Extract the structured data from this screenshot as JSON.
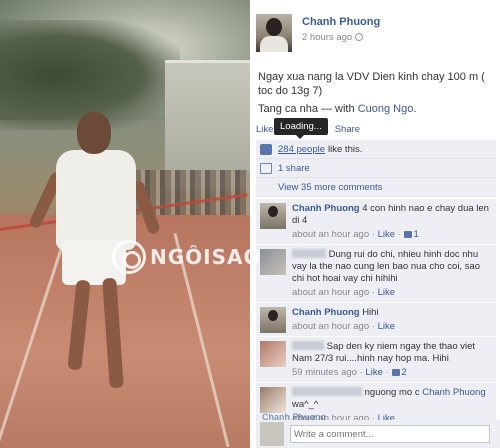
{
  "post": {
    "author": "Chanh Phuong",
    "time": "2 hours ago",
    "text_line1": "Ngay xua nang la VDV Dien kinh chay 100 m ( toc do 13g 7)",
    "text_line2_prefix": "Tang ca nha — with",
    "text_line2_tag": "Cuong Ngo",
    "text_line2_suffix": "."
  },
  "actions": {
    "like": "Like",
    "share": "Share"
  },
  "tooltip": "Loading...",
  "ufi": {
    "likes_link": "284 people",
    "likes_suffix": "like this.",
    "shares": "1 share",
    "view_comments": "View 35 more comments"
  },
  "comments": [
    {
      "author": "Chanh Phuong",
      "text": "4 con hinh nao e chay dua len di 4",
      "time": "about an hour ago",
      "like": "Like",
      "likes": "1",
      "avatar": "cp"
    },
    {
      "author": "",
      "text": "Dung rui do chi, nhieu hinh doc nhu vay la the nao cung len bao nua cho coi, sao chi hot hoai vay chi hihihi",
      "time": "about an hour ago",
      "like": "Like",
      "likes": "",
      "avatar": "g1"
    },
    {
      "author": "Chanh Phuong",
      "text": "Hihi",
      "time": "about an hour ago",
      "like": "Like",
      "likes": "",
      "avatar": "cp"
    },
    {
      "author": "",
      "text": "Sap den ky niem ngay the thao viet Nam 27/3 rui....hinh nay hop ma. Hihi",
      "time": "59 minutes ago",
      "like": "Like",
      "likes": "2",
      "avatar": "g2"
    },
    {
      "author": "",
      "text_prefix": "nguong mo c",
      "tag": "Chanh Phuong",
      "text": "wa^_^",
      "time": "about an hour ago",
      "like": "Like",
      "likes": "",
      "avatar": "g3"
    }
  ],
  "partial_name": "Chanh Phuong",
  "composer": {
    "placeholder": "Write a comment..."
  },
  "watermark": "NGÔISAO"
}
